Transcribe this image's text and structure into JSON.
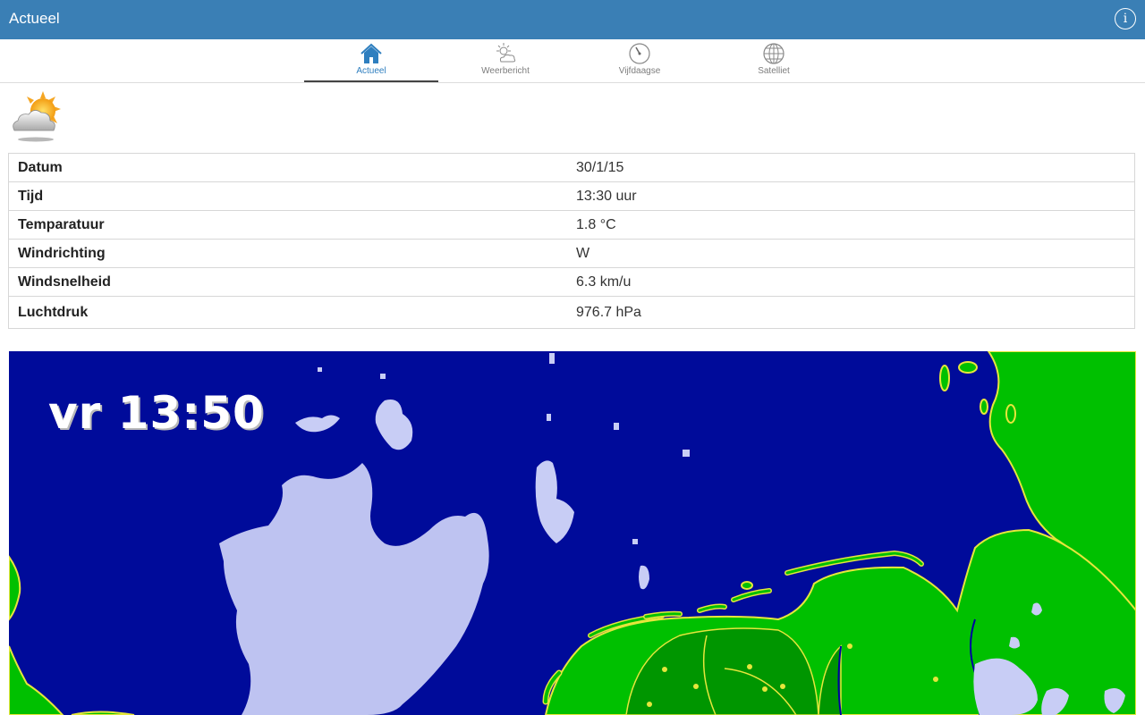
{
  "navbar": {
    "title": "Actueel",
    "info_icon": "info-icon",
    "info_glyph": "i",
    "background": "#3a7fb5"
  },
  "tabs": [
    {
      "label": "Actueel",
      "icon": "home-icon",
      "active": true
    },
    {
      "label": "Weerbericht",
      "icon": "sun-cloud-icon",
      "active": false
    },
    {
      "label": "Vijfdaagse",
      "icon": "dial-icon",
      "active": false
    },
    {
      "label": "Satelliet",
      "icon": "globe-icon",
      "active": false
    }
  ],
  "current": {
    "weather_icon": "partly-cloudy-icon",
    "rows": [
      {
        "label": "Datum",
        "value": "30/1/15"
      },
      {
        "label": "Tijd",
        "value": "13:30 uur"
      },
      {
        "label": "Temparatuur",
        "value": "1.8 °C"
      },
      {
        "label": "Windrichting",
        "value": "W"
      },
      {
        "label": "Windsnelheid",
        "value": "6.3 km/u"
      },
      {
        "label": "Luchtdruk",
        "value": "976.7 hPa"
      }
    ]
  },
  "radar": {
    "timestamp": "vr 13:50",
    "sea_color": "#000b9a",
    "land_color": "#00c800",
    "precipitation_color": "#c8cdf5"
  }
}
